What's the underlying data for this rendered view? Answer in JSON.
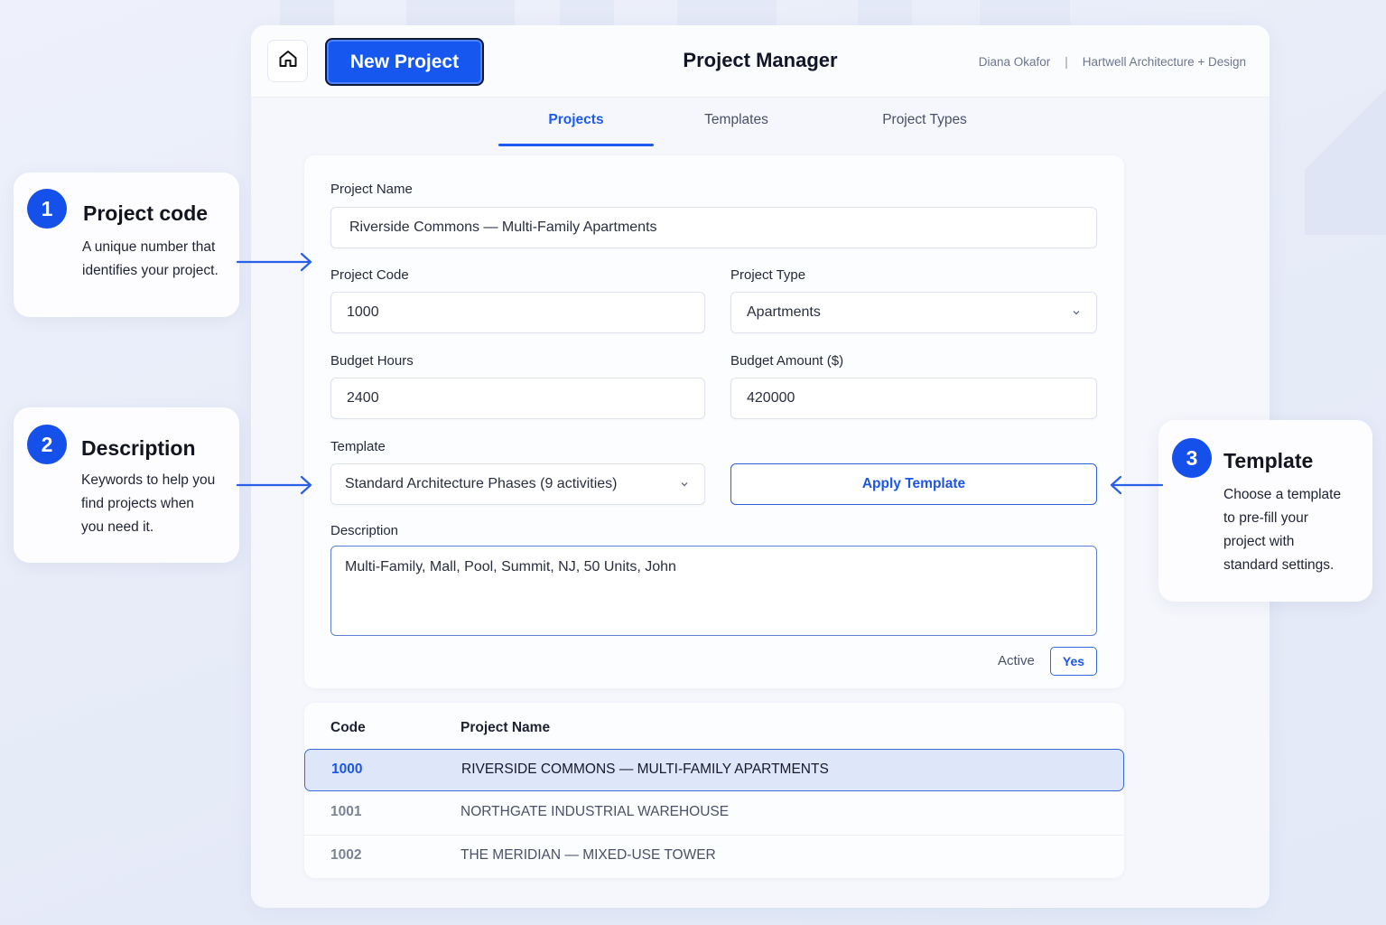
{
  "header": {
    "new_project_label": "New Project",
    "title": "Project Manager",
    "user_name": "Diana Okafor",
    "separator": "|",
    "company": "Hartwell Architecture + Design"
  },
  "tabs": [
    {
      "label": "Projects",
      "active": true
    },
    {
      "label": "Templates",
      "active": false
    },
    {
      "label": "Project Types",
      "active": false
    }
  ],
  "form": {
    "project_name_label": "Project Name",
    "project_name_value": "Riverside Commons — Multi-Family Apartments",
    "project_code_label": "Project Code",
    "project_code_value": "1000",
    "project_type_label": "Project Type",
    "project_type_value": "Apartments",
    "budget_hours_label": "Budget Hours",
    "budget_hours_value": "2400",
    "budget_amount_label": "Budget Amount ($)",
    "budget_amount_value": "420000",
    "template_label": "Template",
    "template_value": "Standard Architecture Phases (9 activities)",
    "apply_template_label": "Apply Template",
    "description_label": "Description",
    "description_value": "Multi-Family, Mall, Pool, Summit, NJ, 50 Units, John",
    "active_label": "Active",
    "active_value": "Yes"
  },
  "table": {
    "columns": [
      "Code",
      "Project Name"
    ],
    "rows": [
      {
        "code": "1000",
        "name": "RIVERSIDE COMMONS — MULTI-FAMILY APARTMENTS",
        "selected": true
      },
      {
        "code": "1001",
        "name": "NORTHGATE INDUSTRIAL WAREHOUSE",
        "selected": false
      },
      {
        "code": "1002",
        "name": "THE MERIDIAN — MIXED-USE TOWER",
        "selected": false
      }
    ]
  },
  "callouts": [
    {
      "number": "1",
      "title": "Project code",
      "lines": [
        "A unique number that",
        "identifies your project."
      ]
    },
    {
      "number": "2",
      "title": "Description",
      "lines": [
        "Keywords to help you",
        "find projects when",
        "you need it."
      ]
    },
    {
      "number": "3",
      "title": "Template",
      "lines": [
        "Choose a template",
        "to pre-fill your",
        "project with",
        "standard settings."
      ]
    }
  ],
  "colors": {
    "accent": "#1657ef",
    "selected_row": "#dee6fa",
    "background": "#eef1fb"
  },
  "icons": [
    "home-icon",
    "chevron-down-icon",
    "arrow-right-icon",
    "arrow-left-icon"
  ]
}
